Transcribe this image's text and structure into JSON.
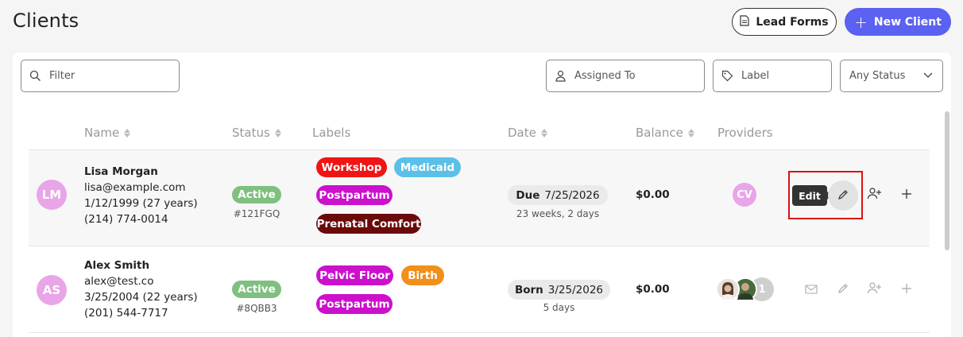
{
  "page": {
    "title": "Clients"
  },
  "header": {
    "lead_forms_label": "Lead Forms",
    "new_client_label": "New Client"
  },
  "filters": {
    "filter_placeholder": "Filter",
    "assigned_placeholder": "Assigned To",
    "label_placeholder": "Label",
    "status_value": "Any Status"
  },
  "columns": [
    "Name",
    "Status",
    "Labels",
    "Date",
    "Balance",
    "Providers"
  ],
  "rows": [
    {
      "initials": "LM",
      "name": "Lisa Morgan",
      "email": "lisa@example.com",
      "dob": "1/12/1999 (27 years)",
      "phone": "(214) 774-0014",
      "status": "Active",
      "status_id": "#121FGQ",
      "labels": [
        {
          "text": "Workshop",
          "color": "#f01414"
        },
        {
          "text": "Medicaid",
          "color": "#5bc0e8"
        },
        {
          "text": "Postpartum",
          "color": "#cc11cc"
        },
        {
          "text": "Prenatal Comfort",
          "color": "#6b0a0a"
        }
      ],
      "date_kind": "Due",
      "date": "7/25/2026",
      "date_sub": "23 weeks, 2 days",
      "balance": "$0.00",
      "provider_initials": "CV"
    },
    {
      "initials": "AS",
      "name": "Alex Smith",
      "email": "alex@test.co",
      "dob": "3/25/2004 (22 years)",
      "phone": "(201) 544-7717",
      "status": "Active",
      "status_id": "#8QBB3",
      "labels": [
        {
          "text": "Pelvic Floor",
          "color": "#cc11cc"
        },
        {
          "text": "Birth",
          "color": "#f0901a"
        },
        {
          "text": "Postpartum",
          "color": "#cc11cc"
        }
      ],
      "date_kind": "Born",
      "date": "3/25/2026",
      "date_sub": "5 days",
      "balance": "$0.00",
      "provider_extra": "1"
    }
  ],
  "tooltip": {
    "edit_label": "Edit"
  },
  "colors": {
    "accent": "#5b61f0",
    "status_active": "#7fbf7f",
    "avatar": "#e8a5e8",
    "highlight": "#dd1111"
  }
}
